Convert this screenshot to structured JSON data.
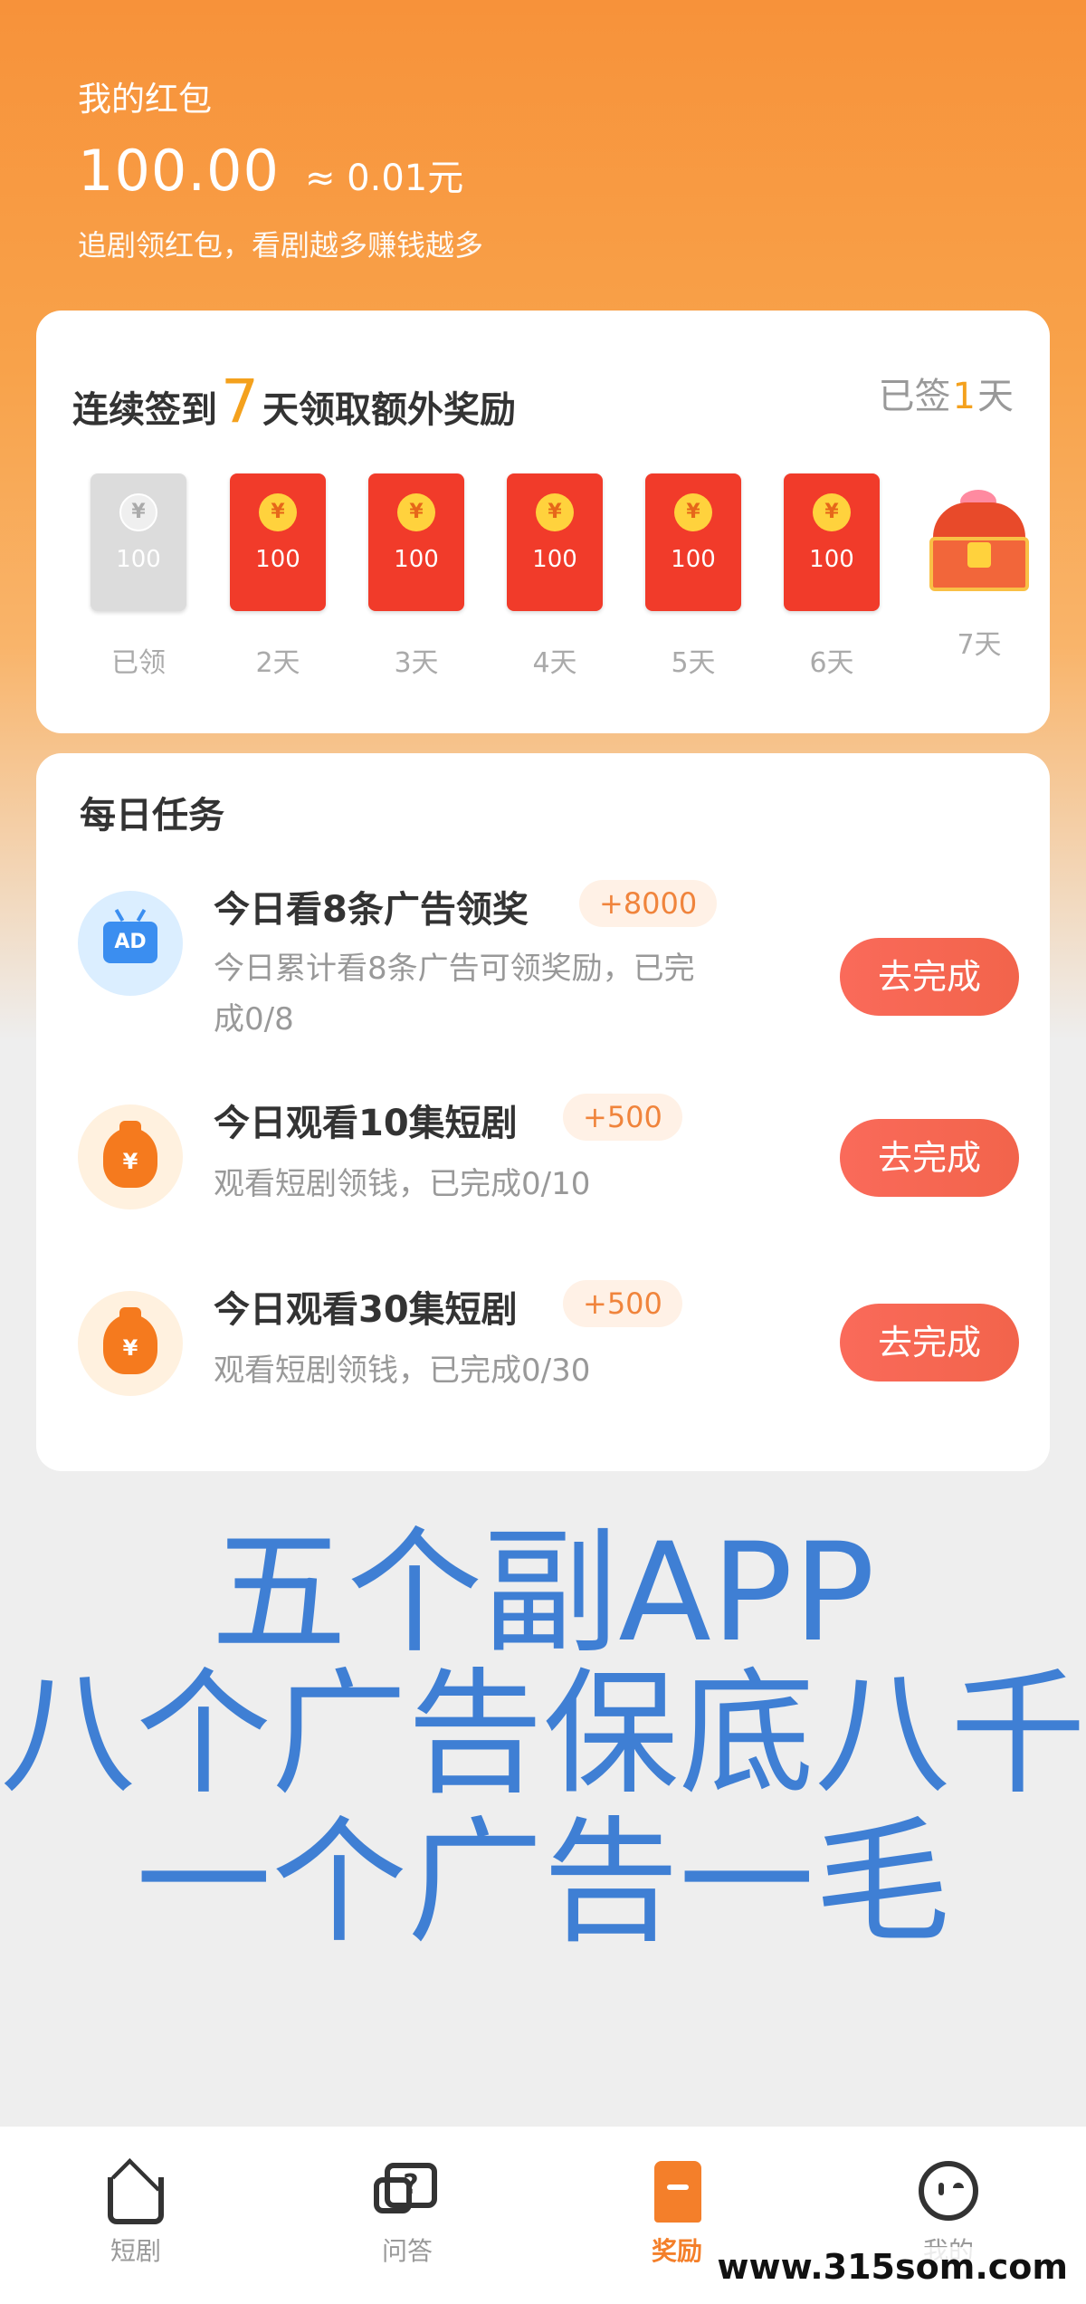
{
  "header": {
    "title": "我的红包",
    "amount": "100.00",
    "approx": "≈ 0.01元",
    "tip": "追剧领红包，看剧越多赚钱越多"
  },
  "signin": {
    "prefix": "连续签到",
    "days": "7",
    "suffix": "天领取额外奖励",
    "signed_prefix": "已签",
    "signed_num": "1",
    "signed_suffix": "天",
    "items": [
      {
        "value": "100",
        "label": "已领",
        "claimed": true
      },
      {
        "value": "100",
        "label": "2天"
      },
      {
        "value": "100",
        "label": "3天"
      },
      {
        "value": "100",
        "label": "4天"
      },
      {
        "value": "100",
        "label": "5天"
      },
      {
        "value": "100",
        "label": "6天"
      },
      {
        "value": "",
        "label": "7天",
        "icon": "treasure-chest-icon"
      }
    ],
    "coin_symbol": "¥"
  },
  "tasks": {
    "heading": "每日任务",
    "items": [
      {
        "name": "今日看8条广告领奖",
        "badge": "+8000",
        "desc": "今日累计看8条广告可领奖励，已完成0/8",
        "button": "去完成",
        "icon": "ad-tv-icon",
        "icon_text": "AD"
      },
      {
        "name": "今日观看10集短剧",
        "badge": "+500",
        "desc": "观看短剧领钱，已完成0/10",
        "button": "去完成",
        "icon": "money-bag-icon",
        "icon_text": "¥"
      },
      {
        "name": "今日观看30集短剧",
        "badge": "+500",
        "desc": "观看短剧领钱，已完成0/30",
        "button": "去完成",
        "icon": "money-bag-icon",
        "icon_text": "¥"
      }
    ]
  },
  "promo": {
    "line1": "五个副APP",
    "line2": "八个广告保底八千",
    "line3": "一个广告一毛"
  },
  "tabbar": {
    "items": [
      {
        "label": "短剧",
        "icon": "home-icon"
      },
      {
        "label": "问答",
        "icon": "qa-icon"
      },
      {
        "label": "奖励",
        "icon": "bookmark-icon",
        "active": true
      },
      {
        "label": "我的",
        "icon": "face-icon"
      }
    ],
    "qa_mark": "?"
  },
  "watermark": "www.315som.com",
  "colors": {
    "accent": "#f47f2a",
    "button": "#f2644b",
    "promo": "#3f7fd4",
    "gold": "#f4a11d"
  }
}
